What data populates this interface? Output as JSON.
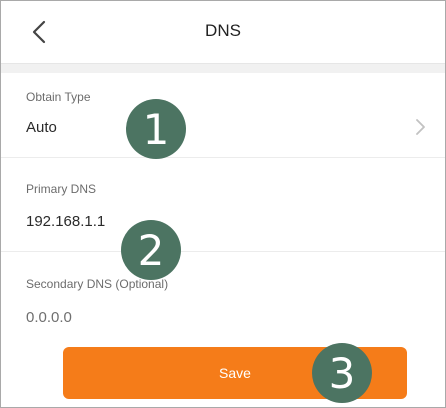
{
  "header": {
    "title": "DNS",
    "back_icon": "chevron-left-icon"
  },
  "fields": {
    "obtain_type": {
      "label": "Obtain Type",
      "value": "Auto",
      "chevron_icon": "chevron-right-icon"
    },
    "primary_dns": {
      "label": "Primary DNS",
      "value": "192.168.1.1"
    },
    "secondary_dns": {
      "label": "Secondary DNS (Optional)",
      "value": "0.0.0.0"
    }
  },
  "save_button": {
    "label": "Save",
    "color": "#f57c19"
  },
  "callouts": [
    "1",
    "2",
    "3"
  ],
  "colors": {
    "callout": "#4c7462",
    "background": "#f1f1f1"
  }
}
